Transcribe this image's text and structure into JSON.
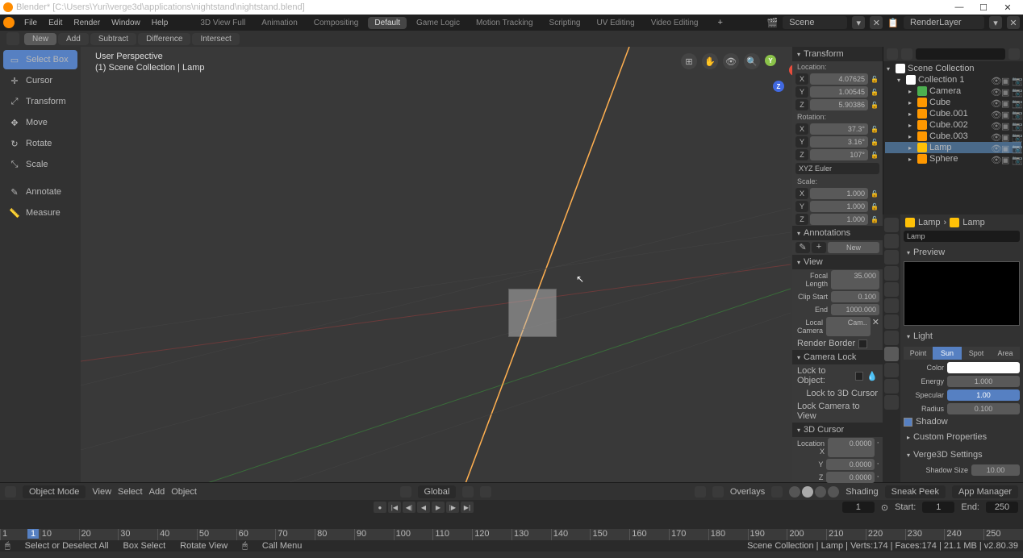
{
  "title": "Blender* [C:\\Users\\Yuri\\verge3d\\applications\\nightstand\\nightstand.blend]",
  "menu": [
    "File",
    "Edit",
    "Render",
    "Window",
    "Help"
  ],
  "workspaces": [
    "3D View Full",
    "Animation",
    "Compositing",
    "Default",
    "Game Logic",
    "Motion Tracking",
    "Scripting",
    "UV Editing",
    "Video Editing"
  ],
  "active_workspace": 3,
  "scene": "Scene",
  "render_layer": "RenderLayer",
  "modebar": {
    "mode_icon": "⊞",
    "new": "New",
    "add": "Add",
    "subtract": "Subtract",
    "difference": "Difference",
    "intersect": "Intersect"
  },
  "tools": [
    {
      "icon": "▭",
      "label": "Select Box",
      "active": true
    },
    {
      "icon": "✛",
      "label": "Cursor"
    },
    {
      "icon": "⤢",
      "label": "Transform"
    },
    {
      "icon": "✥",
      "label": "Move"
    },
    {
      "icon": "↻",
      "label": "Rotate"
    },
    {
      "icon": "⤡",
      "label": "Scale"
    },
    {
      "icon": "✎",
      "label": "Annotate",
      "sep": true
    },
    {
      "icon": "📏",
      "label": "Measure"
    }
  ],
  "overlay": {
    "line1": "User Perspective",
    "line2": "(1) Scene Collection | Lamp"
  },
  "gizmo_icons": [
    "⊞",
    "✋",
    "👁",
    "🔍"
  ],
  "transform": {
    "title": "Transform",
    "location_label": "Location:",
    "loc": [
      {
        "a": "X",
        "v": "4.07625"
      },
      {
        "a": "Y",
        "v": "1.00545"
      },
      {
        "a": "Z",
        "v": "5.90386"
      }
    ],
    "rotation_label": "Rotation:",
    "rot": [
      {
        "a": "X",
        "v": "37.3°"
      },
      {
        "a": "Y",
        "v": "3.16°"
      },
      {
        "a": "Z",
        "v": "107°"
      }
    ],
    "rot_mode": "XYZ Euler",
    "scale_label": "Scale:",
    "scl": [
      {
        "a": "X",
        "v": "1.000"
      },
      {
        "a": "Y",
        "v": "1.000"
      },
      {
        "a": "Z",
        "v": "1.000"
      }
    ]
  },
  "annotations": {
    "title": "Annotations",
    "new": "New"
  },
  "view": {
    "title": "View",
    "focal_label": "Focal Length",
    "focal": "35.000",
    "clipstart_label": "Clip Start",
    "clipstart": "0.100",
    "end_label": "End",
    "end": "1000.000",
    "localcam_label": "Local Camera",
    "localcam": "Cam..",
    "renderborder": "Render Border"
  },
  "camlock": {
    "title": "Camera Lock",
    "lock_obj": "Lock to Object:",
    "lock_3d": "Lock to 3D Cursor",
    "lock_view": "Lock Camera to View"
  },
  "cursor3d": {
    "title": "3D Cursor",
    "rows": [
      {
        "l": "Location X",
        "v": "0.0000"
      },
      {
        "l": "Y",
        "v": "0.0000"
      },
      {
        "l": "Z",
        "v": "0.0000"
      }
    ]
  },
  "outliner": {
    "root": "Scene Collection",
    "coll": "Collection 1",
    "items": [
      {
        "type": "cam",
        "name": "Camera"
      },
      {
        "type": "mesh",
        "name": "Cube"
      },
      {
        "type": "mesh",
        "name": "Cube.001"
      },
      {
        "type": "mesh",
        "name": "Cube.002"
      },
      {
        "type": "mesh",
        "name": "Cube.003"
      },
      {
        "type": "lamp",
        "name": "Lamp",
        "sel": true
      },
      {
        "type": "sphere",
        "name": "Sphere"
      }
    ]
  },
  "props": {
    "breadcrumb1": "Lamp",
    "breadcrumb2": "Lamp",
    "name": "Lamp",
    "preview": "Preview",
    "light": "Light",
    "light_types": [
      "Point",
      "Sun",
      "Spot",
      "Area"
    ],
    "light_active": 1,
    "color_label": "Color",
    "energy_label": "Energy",
    "energy": "1.000",
    "specular_label": "Specular",
    "specular": "1.00",
    "radius_label": "Radius",
    "radius": "0.100",
    "shadow": "Shadow",
    "custom": "Custom Properties",
    "verge": "Verge3D Settings",
    "shadowsize_label": "Shadow Size",
    "shadowsize": "10.00"
  },
  "viewhdr": {
    "mode": "Object Mode",
    "menus": [
      "View",
      "Select",
      "Add",
      "Object"
    ],
    "orient": "Global",
    "overlays": "Overlays",
    "shading": "Shading",
    "sneak": "Sneak Peek",
    "appmgr": "App Manager"
  },
  "timeline": {
    "frame": "1",
    "start_label": "Start:",
    "start": "1",
    "end_label": "End:",
    "end": "250",
    "marks": [
      "1",
      "10",
      "20",
      "30",
      "40",
      "50",
      "60",
      "70",
      "80",
      "90",
      "100",
      "110",
      "120",
      "130",
      "140",
      "150",
      "160",
      "170",
      "180",
      "190",
      "200",
      "210",
      "220",
      "230",
      "240",
      "250"
    ]
  },
  "status": {
    "left1": "Select or Deselect All",
    "left2": "Box Select",
    "left3": "Rotate View",
    "left4": "Call Menu",
    "right": "Scene Collection | Lamp | Verts:174 | Faces:174 | 21.1 MB | v2.80.39"
  }
}
